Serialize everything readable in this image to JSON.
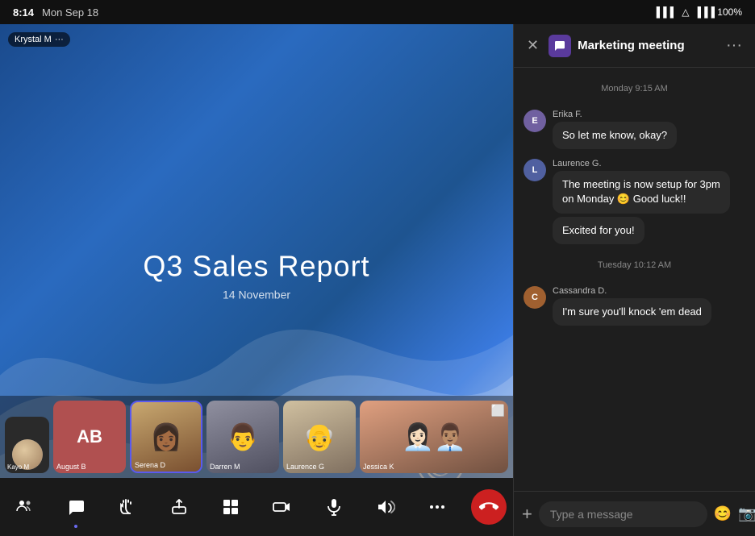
{
  "statusBar": {
    "time": "8:14",
    "date": "Mon Sep 18",
    "battery": "100%"
  },
  "presentation": {
    "title": "Q3 Sales Report",
    "subtitle": "14 November"
  },
  "participants": [
    {
      "id": "kayo",
      "label": "Kayo M",
      "type": "self",
      "initials": ""
    },
    {
      "id": "august",
      "label": "August B",
      "type": "initials",
      "initials": "AB",
      "color": "#b05050"
    },
    {
      "id": "serena",
      "label": "Serena D",
      "type": "photo",
      "active": true
    },
    {
      "id": "darren",
      "label": "Darren M",
      "type": "photo"
    },
    {
      "id": "laurence",
      "label": "Laurence G",
      "type": "photo"
    },
    {
      "id": "jessica",
      "label": "Jessica K",
      "type": "photo-wide"
    }
  ],
  "activeSpeaker": {
    "name": "Krystal M",
    "badge": "Krystal M ···"
  },
  "toolbar": {
    "buttons": [
      {
        "id": "participants",
        "label": "Participants",
        "icon": "👥"
      },
      {
        "id": "chat",
        "label": "Chat",
        "icon": "💬",
        "active": true
      },
      {
        "id": "raise-hand",
        "label": "Raise Hand",
        "icon": "✋"
      },
      {
        "id": "share",
        "label": "Share",
        "icon": "⬆"
      },
      {
        "id": "grid",
        "label": "Grid",
        "icon": "⊞"
      },
      {
        "id": "video",
        "label": "Video",
        "icon": "📷"
      },
      {
        "id": "mic",
        "label": "Microphone",
        "icon": "🎤"
      },
      {
        "id": "speaker",
        "label": "Speaker",
        "icon": "🔊"
      },
      {
        "id": "more",
        "label": "More",
        "icon": "···"
      },
      {
        "id": "end-call",
        "label": "End Call",
        "icon": "📞"
      }
    ]
  },
  "chat": {
    "title": "Marketing meeting",
    "dateSeparator1": "Monday 9:15 AM",
    "dateSeparator2": "Tuesday 10:12 AM",
    "messages": [
      {
        "id": "m1",
        "sender": "Erika F.",
        "avatarColor": "#7060a0",
        "bubbles": [
          "So let me know, okay?"
        ]
      },
      {
        "id": "m2",
        "sender": "Laurence G.",
        "avatarColor": "#5060a0",
        "bubbles": [
          "The meeting is now setup for 3pm on Monday 😊 Good luck!!",
          "Excited for you!"
        ]
      },
      {
        "id": "m3",
        "sender": "Cassandra D.",
        "avatarColor": "#a06030",
        "bubbles": [
          "I'm sure you'll knock 'em dead"
        ]
      }
    ],
    "inputPlaceholder": "Type a message"
  }
}
